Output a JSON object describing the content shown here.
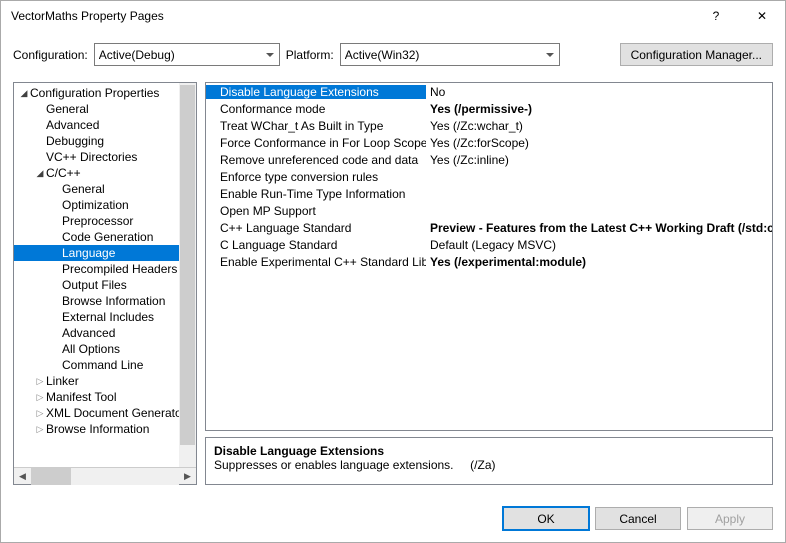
{
  "window": {
    "title": "VectorMaths Property Pages"
  },
  "toolbar": {
    "config_label": "Configuration:",
    "config_value": "Active(Debug)",
    "platform_label": "Platform:",
    "platform_value": "Active(Win32)",
    "cfg_mgr": "Configuration Manager..."
  },
  "tree": {
    "root": "Configuration Properties",
    "items": [
      "General",
      "Advanced",
      "Debugging",
      "VC++ Directories"
    ],
    "ccpp": "C/C++",
    "ccpp_items": [
      "General",
      "Optimization",
      "Preprocessor",
      "Code Generation",
      "Language",
      "Precompiled Headers",
      "Output Files",
      "Browse Information",
      "External Includes",
      "Advanced",
      "All Options",
      "Command Line"
    ],
    "after": [
      "Linker",
      "Manifest Tool",
      "XML Document Generator",
      "Browse Information"
    ]
  },
  "grid": [
    {
      "prop": "Disable Language Extensions",
      "val": "No",
      "bold": false,
      "sel": true
    },
    {
      "prop": "Conformance mode",
      "val": "Yes (/permissive-)",
      "bold": true
    },
    {
      "prop": "Treat WChar_t As Built in Type",
      "val": "Yes (/Zc:wchar_t)",
      "bold": false
    },
    {
      "prop": "Force Conformance in For Loop Scope",
      "val": "Yes (/Zc:forScope)",
      "bold": false
    },
    {
      "prop": "Remove unreferenced code and data",
      "val": "Yes (/Zc:inline)",
      "bold": false
    },
    {
      "prop": "Enforce type conversion rules",
      "val": "",
      "bold": false
    },
    {
      "prop": "Enable Run-Time Type Information",
      "val": "",
      "bold": false
    },
    {
      "prop": "Open MP Support",
      "val": "",
      "bold": false
    },
    {
      "prop": "C++ Language Standard",
      "val": "Preview - Features from the Latest C++ Working Draft (/std:c++latest)",
      "bold": true
    },
    {
      "prop": "C Language Standard",
      "val": "Default (Legacy MSVC)",
      "bold": false
    },
    {
      "prop": "Enable Experimental C++ Standard Library Modules",
      "val": "Yes (/experimental:module)",
      "bold": true
    }
  ],
  "desc": {
    "title": "Disable Language Extensions",
    "body": "Suppresses or enables language extensions.     (/Za)"
  },
  "footer": {
    "ok": "OK",
    "cancel": "Cancel",
    "apply": "Apply"
  }
}
